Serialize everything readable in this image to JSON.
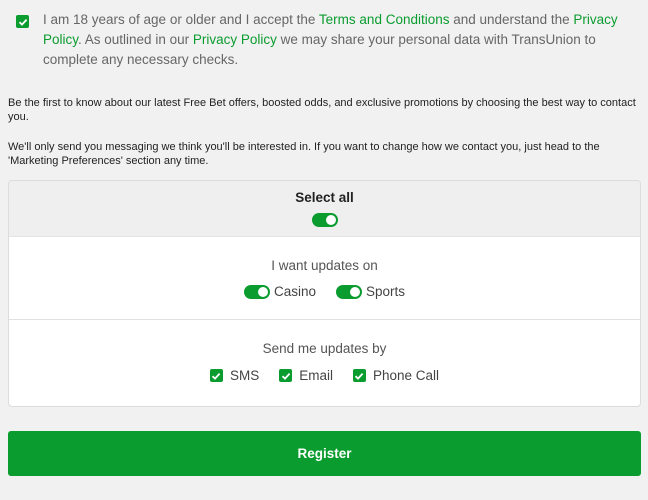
{
  "consent": {
    "text_before": "I am 18 years of age or older and I accept the ",
    "terms_link": "Terms and Conditions",
    "text_middle": " and understand the ",
    "privacy_link_1": "Privacy Policy",
    "text_after_1": ". As outlined in our ",
    "privacy_link_2": "Privacy Policy",
    "text_after_2": " we may share your personal data with TransUnion to complete any necessary checks.",
    "checked": true
  },
  "marketing": {
    "intro": "Be the first to know about our latest Free Bet offers, boosted odds, and exclusive promotions by choosing the best way to contact you.",
    "note": "We'll only send you messaging we think you'll be interested in. If you want to change how we contact you, just head to the 'Marketing Preferences' section any time."
  },
  "preferences": {
    "select_all_label": "Select all",
    "products_label": "I want updates on",
    "products": [
      {
        "label": "Casino",
        "on": true
      },
      {
        "label": "Sports",
        "on": true
      }
    ],
    "channels_label": "Send me updates by",
    "channels": [
      {
        "label": "SMS",
        "checked": true
      },
      {
        "label": "Email",
        "checked": true
      },
      {
        "label": "Phone Call",
        "checked": true
      }
    ]
  },
  "register_label": "Register",
  "colors": {
    "accent": "#0b9c2f",
    "background": "#f1f1f1"
  }
}
